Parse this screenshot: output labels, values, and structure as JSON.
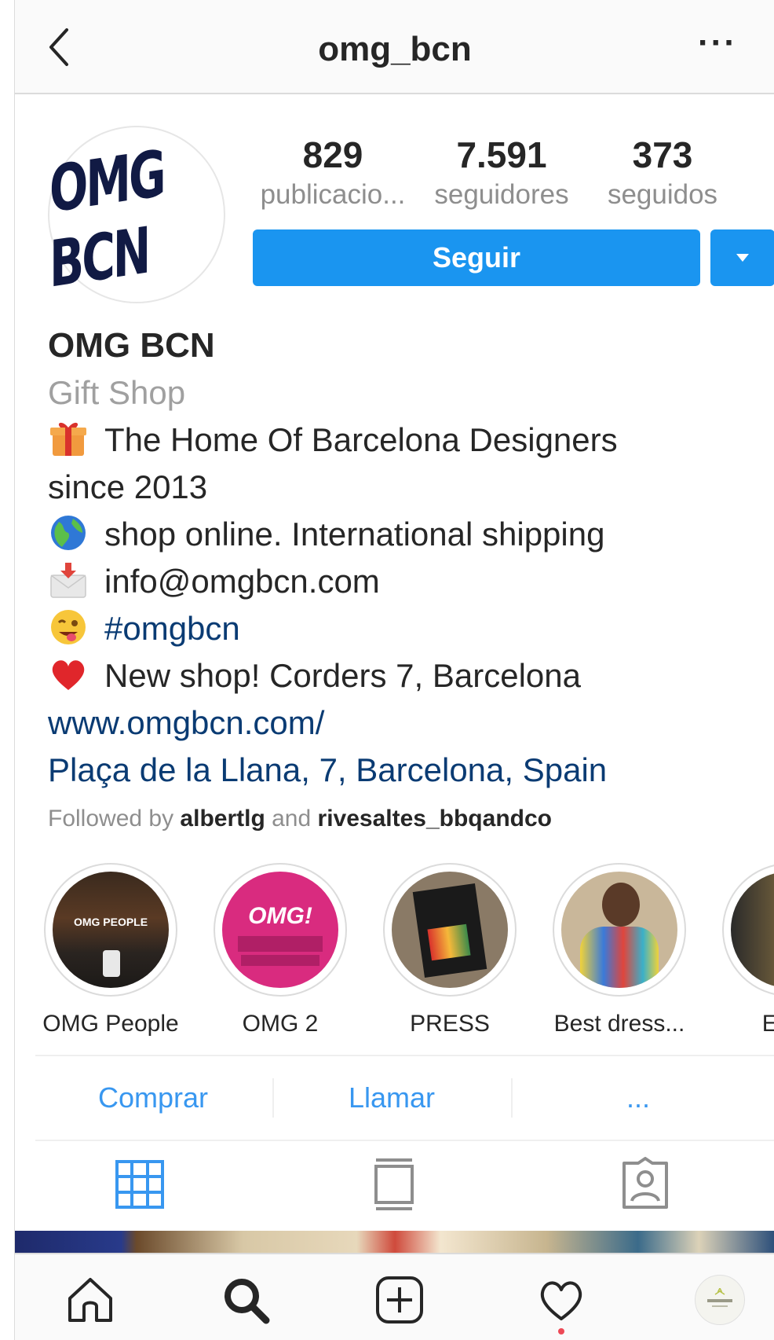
{
  "header": {
    "title": "omg_bcn",
    "more_label": "···"
  },
  "profile": {
    "avatar_text": "OMG BCN",
    "stats": [
      {
        "value": "829",
        "label": "publicacio..."
      },
      {
        "value": "7.591",
        "label": "seguidores"
      },
      {
        "value": "373",
        "label": "seguidos"
      }
    ],
    "follow_label": "Seguir"
  },
  "bio": {
    "name": "OMG BCN",
    "category": "Gift Shop",
    "lines": [
      {
        "icon": "gift-icon",
        "text": "The Home Of Barcelona Designers"
      },
      {
        "icon": "",
        "text": "since 2013"
      },
      {
        "icon": "globe-icon",
        "text": "shop online. International shipping"
      },
      {
        "icon": "envelope-icon",
        "text": "info@omgbcn.com"
      },
      {
        "icon": "winking-face-icon",
        "text": "#omgbcn"
      },
      {
        "icon": "heart-icon",
        "text": "New shop! Corders 7, Barcelona"
      }
    ],
    "website": "www.omgbcn.com/",
    "address": "Plaça de la Llana, 7, Barcelona, Spain",
    "followed_by": {
      "prefix": "Followed by",
      "user1": "albertlg",
      "joiner": "and",
      "user2": "rivesaltes_bbqandco"
    }
  },
  "highlights": [
    {
      "label": "OMG People",
      "thumb_text": "OMG PEOPLE"
    },
    {
      "label": "OMG 2",
      "thumb_text": "OMG!"
    },
    {
      "label": "PRESS",
      "thumb_text": ""
    },
    {
      "label": "Best dress...",
      "thumb_text": ""
    },
    {
      "label": "Expa",
      "thumb_text": ""
    }
  ],
  "actions": {
    "shop": "Comprar",
    "call": "Llamar",
    "more": "..."
  },
  "colors": {
    "accent": "#1a95f0",
    "link": "#3897f0",
    "dark_link": "#0a3b73",
    "muted": "#8e8e8e"
  }
}
